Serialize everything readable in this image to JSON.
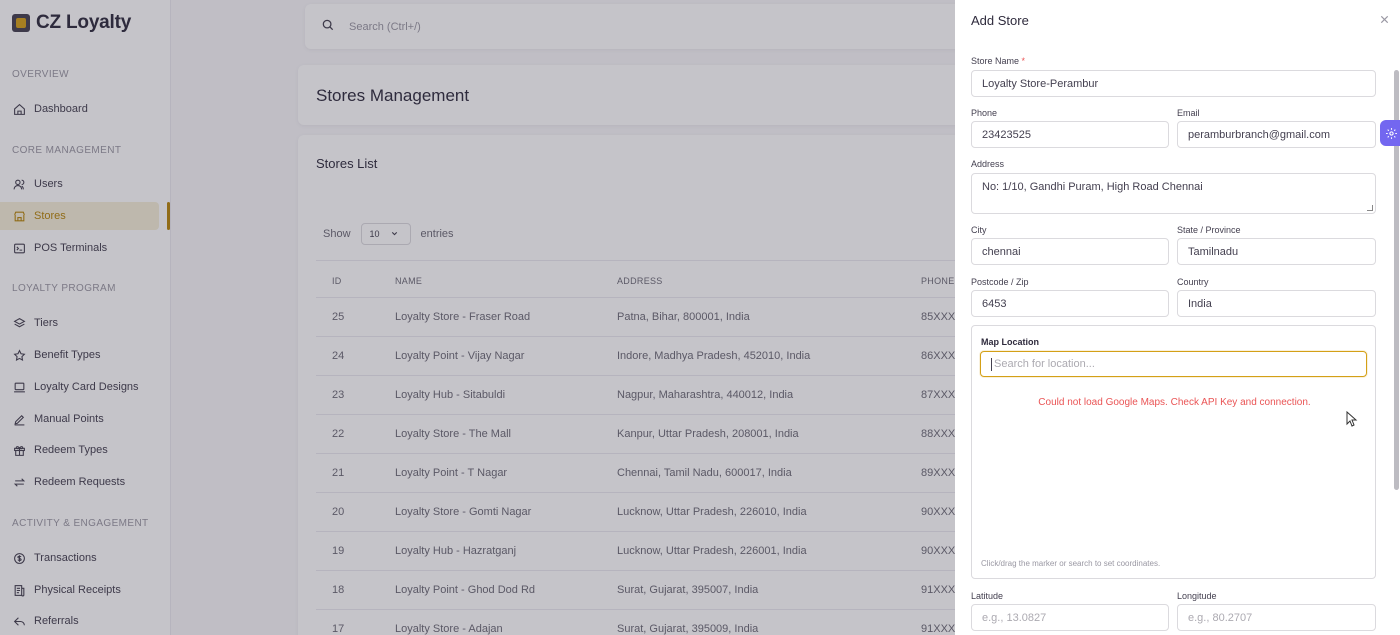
{
  "brand": {
    "name": "CZ Loyalty",
    "collapse_icon": "chevron-left-icon"
  },
  "sidebar": {
    "sections": [
      {
        "label": "OVERVIEW"
      },
      {
        "label": "CORE MANAGEMENT"
      },
      {
        "label": "LOYALTY PROGRAM"
      },
      {
        "label": "ACTIVITY & ENGAGEMENT"
      }
    ],
    "items": [
      {
        "label": "Dashboard",
        "icon": "home-icon"
      },
      {
        "label": "Users",
        "icon": "users-icon"
      },
      {
        "label": "Stores",
        "icon": "store-icon",
        "active": true
      },
      {
        "label": "POS Terminals",
        "icon": "terminal-icon"
      },
      {
        "label": "Tiers",
        "icon": "layers-icon"
      },
      {
        "label": "Benefit Types",
        "icon": "star-icon"
      },
      {
        "label": "Loyalty Card Designs",
        "icon": "card-icon"
      },
      {
        "label": "Manual Points",
        "icon": "pencil-icon"
      },
      {
        "label": "Redeem Types",
        "icon": "gift-icon"
      },
      {
        "label": "Redeem Requests",
        "icon": "swap-icon"
      },
      {
        "label": "Transactions",
        "icon": "dollar-icon"
      },
      {
        "label": "Physical Receipts",
        "icon": "receipt-icon"
      },
      {
        "label": "Referrals",
        "icon": "share-icon"
      }
    ]
  },
  "search": {
    "placeholder": "Search (Ctrl+/)"
  },
  "page": {
    "title": "Stores Management"
  },
  "stores_list": {
    "title": "Stores List",
    "show_label": "Show",
    "entries_value": "10",
    "entries_label": "entries",
    "columns": [
      "ID",
      "NAME",
      "ADDRESS",
      "PHONE"
    ],
    "rows": [
      {
        "id": "25",
        "name": "Loyalty Store - Fraser Road",
        "address": "Patna, Bihar, 800001, India",
        "phone": "85XXX"
      },
      {
        "id": "24",
        "name": "Loyalty Point - Vijay Nagar",
        "address": "Indore, Madhya Pradesh, 452010, India",
        "phone": "86XXX"
      },
      {
        "id": "23",
        "name": "Loyalty Hub - Sitabuldi",
        "address": "Nagpur, Maharashtra, 440012, India",
        "phone": "87XXX"
      },
      {
        "id": "22",
        "name": "Loyalty Store - The Mall",
        "address": "Kanpur, Uttar Pradesh, 208001, India",
        "phone": "88XXX"
      },
      {
        "id": "21",
        "name": "Loyalty Point - T Nagar",
        "address": "Chennai, Tamil Nadu, 600017, India",
        "phone": "89XXX"
      },
      {
        "id": "20",
        "name": "Loyalty Store - Gomti Nagar",
        "address": "Lucknow, Uttar Pradesh, 226010, India",
        "phone": "90XXX"
      },
      {
        "id": "19",
        "name": "Loyalty Hub - Hazratganj",
        "address": "Lucknow, Uttar Pradesh, 226001, India",
        "phone": "90XXX"
      },
      {
        "id": "18",
        "name": "Loyalty Point - Ghod Dod Rd",
        "address": "Surat, Gujarat, 395007, India",
        "phone": "91XXX"
      },
      {
        "id": "17",
        "name": "Loyalty Store - Adajan",
        "address": "Surat, Gujarat, 395009, India",
        "phone": "91XXX"
      }
    ]
  },
  "add_store": {
    "title": "Add Store",
    "close_icon": "close-icon",
    "store_name": {
      "label": "Store Name",
      "required_mark": "*",
      "value": "Loyalty Store-Perambur"
    },
    "phone": {
      "label": "Phone",
      "value": "23423525"
    },
    "email": {
      "label": "Email",
      "value": "peramburbranch@gmail.com"
    },
    "address": {
      "label": "Address",
      "value": "No: 1/10, Gandhi Puram, High Road Chennai"
    },
    "city": {
      "label": "City",
      "value": "chennai"
    },
    "state": {
      "label": "State / Province",
      "value": "Tamilnadu"
    },
    "postcode": {
      "label": "Postcode / Zip",
      "value": "6453"
    },
    "country": {
      "label": "Country",
      "value": "India"
    },
    "map": {
      "title": "Map Location",
      "search_placeholder": "Search for location...",
      "error": "Could not load Google Maps. Check API Key and connection.",
      "hint": "Click/drag the marker or search to set coordinates."
    },
    "latitude": {
      "label": "Latitude",
      "placeholder": "e.g., 13.0827"
    },
    "longitude": {
      "label": "Longitude",
      "placeholder": "e.g., 80.2707"
    }
  },
  "colors": {
    "accent": "#b8860b",
    "error": "#ea5455",
    "customizer": "#7367f0"
  }
}
